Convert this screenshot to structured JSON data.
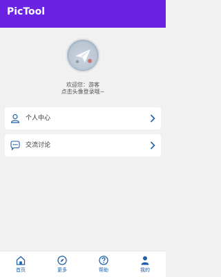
{
  "appbar": {
    "title": "PicTool"
  },
  "profile": {
    "avatar": "paper-plane-avatar",
    "welcome": "欢迎您：游客",
    "hint": "点击头像登录哦~"
  },
  "menu": [
    {
      "label": "个人中心",
      "icon": "user-icon"
    },
    {
      "label": "交流讨论",
      "icon": "chat-icon"
    }
  ],
  "tabbar": [
    {
      "label": "首页",
      "icon": "home-icon"
    },
    {
      "label": "更多",
      "icon": "compass-icon"
    },
    {
      "label": "帮助",
      "icon": "help-icon"
    },
    {
      "label": "我的",
      "icon": "person-icon"
    }
  ],
  "colors": {
    "appbar": "#6a22e3",
    "accent": "#1e5fa8",
    "background": "#f1f1f1"
  }
}
